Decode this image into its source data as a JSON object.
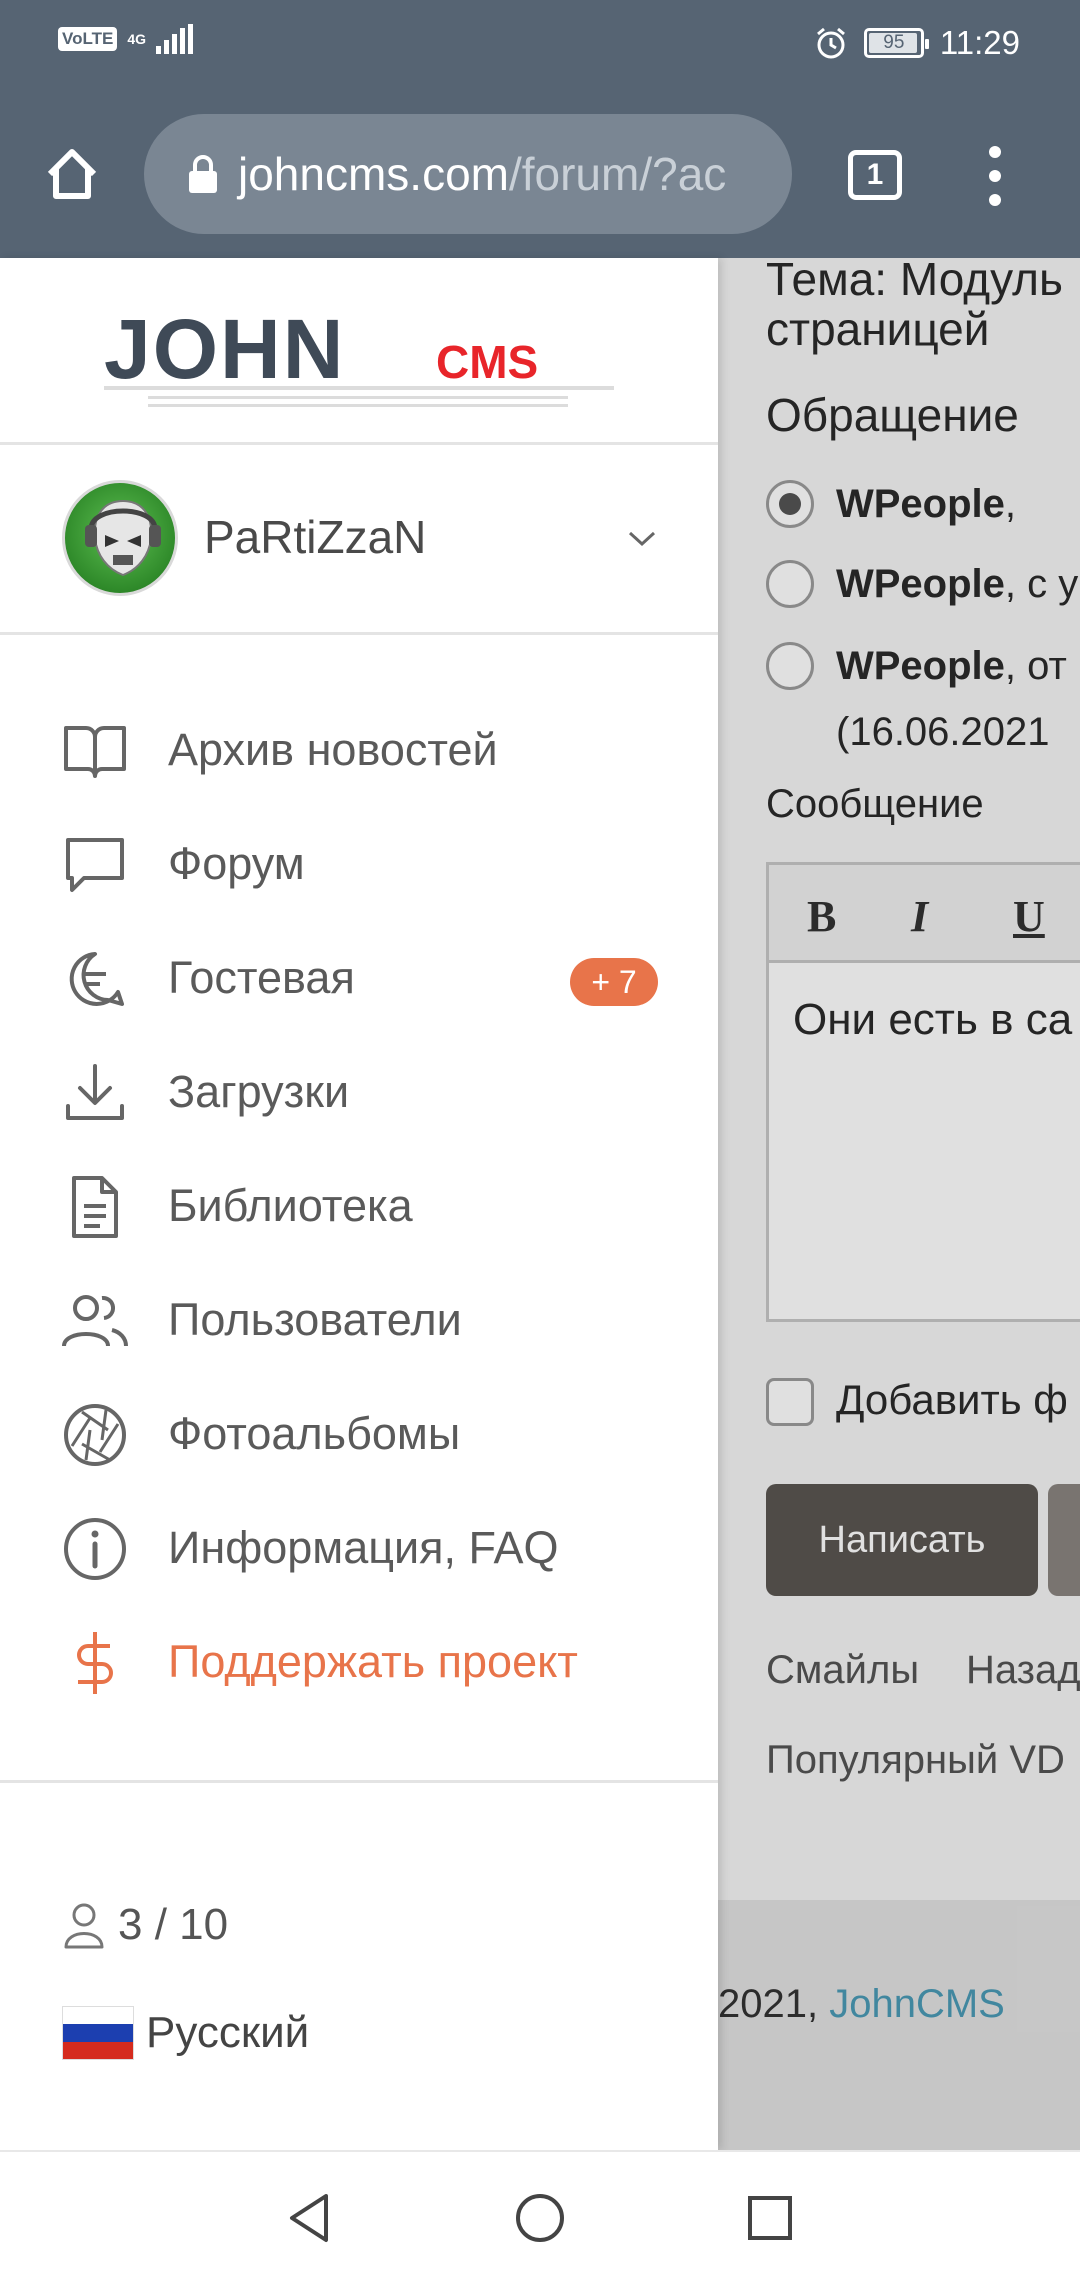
{
  "status_bar": {
    "volte": "VoLTE",
    "network": "4G",
    "battery": "95",
    "time": "11:29"
  },
  "browser": {
    "url_host": "johncms.com",
    "url_path": "/forum/?ac",
    "tab_count": "1"
  },
  "drawer": {
    "logo_john": "JOHN",
    "logo_cms": "CMS",
    "username": "PaRtiZzaN",
    "nav": [
      {
        "label": "Архив новостей",
        "icon": "book-icon"
      },
      {
        "label": "Форум",
        "icon": "chat-bubble-icon"
      },
      {
        "label": "Гостевая",
        "icon": "guestbook-icon",
        "badge": "+ 7"
      },
      {
        "label": "Загрузки",
        "icon": "download-icon"
      },
      {
        "label": "Библиотека",
        "icon": "document-icon"
      },
      {
        "label": "Пользователи",
        "icon": "users-icon"
      },
      {
        "label": "Фотоальбомы",
        "icon": "aperture-icon"
      },
      {
        "label": "Информация, FAQ",
        "icon": "info-icon"
      },
      {
        "label": "Поддержать проект",
        "icon": "dollar-icon"
      }
    ],
    "online_count": "3 / 10",
    "language": "Русский"
  },
  "page": {
    "topic_line1": "Тема: Модуль",
    "topic_line2": "страницей",
    "address_label": "Обращение",
    "radio_options": [
      {
        "name": "WPeople",
        "suffix": ","
      },
      {
        "name": "WPeople",
        "suffix": ", с у"
      },
      {
        "name": "WPeople",
        "suffix": ", от"
      }
    ],
    "date": "(16.06.2021",
    "message_label": "Сообщение",
    "editor_bold": "B",
    "editor_italic": "I",
    "editor_underline": "U",
    "message_text": "Они есть в са",
    "add_file": "Добавить ф",
    "submit": "Написать",
    "smiles": "Смайлы",
    "back": "Назад",
    "popular": "Популярный VD",
    "footer_year": "2021, ",
    "footer_link": "JohnCMS"
  },
  "colors": {
    "header": "#566473",
    "accent": "#e8744a",
    "link": "#4a9ab5"
  }
}
